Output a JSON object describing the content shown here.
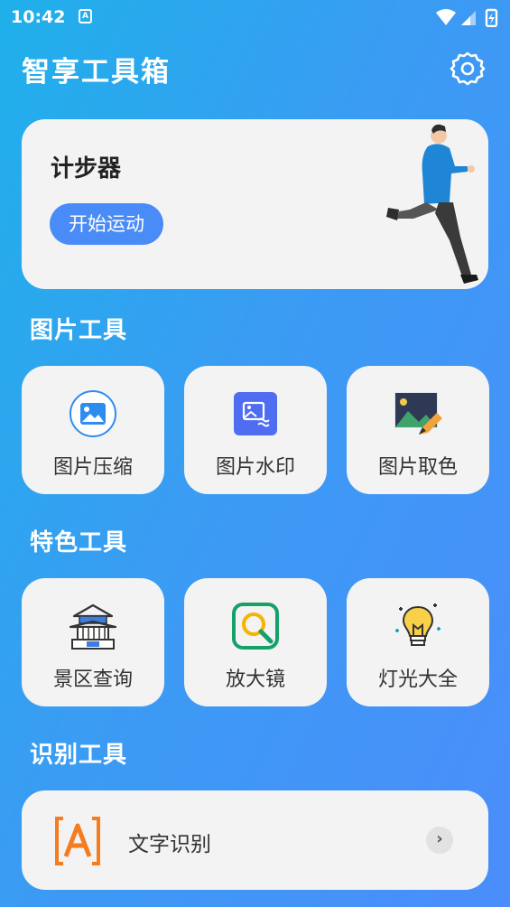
{
  "status_bar": {
    "time": "10:42",
    "notification_badge": "A"
  },
  "header": {
    "title": "智享工具箱",
    "settings_icon": "gear-icon"
  },
  "pedometer": {
    "title": "计步器",
    "button_label": "开始运动"
  },
  "sections": {
    "image_tools": {
      "title": "图片工具",
      "items": [
        {
          "label": "图片压缩",
          "icon": "image-compress-icon"
        },
        {
          "label": "图片水印",
          "icon": "image-watermark-icon"
        },
        {
          "label": "图片取色",
          "icon": "color-picker-icon"
        }
      ]
    },
    "special_tools": {
      "title": "特色工具",
      "items": [
        {
          "label": "景区查询",
          "icon": "pavilion-icon"
        },
        {
          "label": "放大镜",
          "icon": "magnifier-icon"
        },
        {
          "label": "灯光大全",
          "icon": "light-bulb-icon"
        }
      ]
    },
    "recognition_tools": {
      "title": "识别工具",
      "items": [
        {
          "label": "文字识别",
          "icon": "text-recognition-icon"
        }
      ]
    }
  },
  "colors": {
    "background_start": "#1fb0ea",
    "background_end": "#4b8dfb",
    "accent_button": "#4a8cf7",
    "card": "#f3f3f3"
  }
}
